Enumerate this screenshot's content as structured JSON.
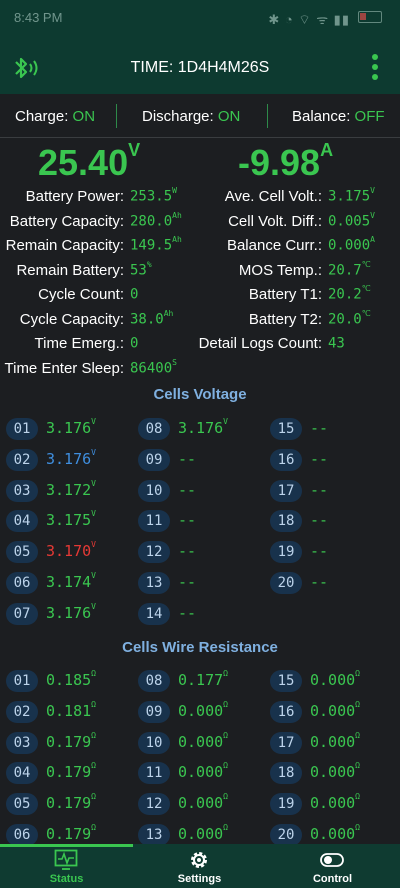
{
  "status_bar": {
    "time": "8:43 PM",
    "icons_text": "✱ ◔ ⌔ ᯤ ▮▮"
  },
  "app_bar": {
    "title": "TIME: 1D4H4M26S"
  },
  "switches": {
    "charge_label": "Charge:",
    "charge_value": "ON",
    "discharge_label": "Discharge:",
    "discharge_value": "ON",
    "balance_label": "Balance:",
    "balance_value": "OFF"
  },
  "voltage": {
    "value": "25.40",
    "unit": "V"
  },
  "current": {
    "value": "-9.98",
    "unit": "A"
  },
  "info_left": [
    {
      "label": "Battery Power:",
      "value": "253.5",
      "unit": "W"
    },
    {
      "label": "Battery Capacity:",
      "value": "280.0",
      "unit": "Ah"
    },
    {
      "label": "Remain Capacity:",
      "value": "149.5",
      "unit": "Ah"
    },
    {
      "label": "Remain Battery:",
      "value": "53",
      "unit": "%"
    },
    {
      "label": "Cycle Count:",
      "value": "0",
      "unit": ""
    },
    {
      "label": "Cycle Capacity:",
      "value": "38.0",
      "unit": "Ah"
    },
    {
      "label": "Time Emerg.:",
      "value": "0",
      "unit": ""
    },
    {
      "label": "Time Enter Sleep:",
      "value": "86400",
      "unit": "S"
    }
  ],
  "info_right": [
    {
      "label": "Ave. Cell Volt.:",
      "value": "3.175",
      "unit": "V"
    },
    {
      "label": "Cell Volt. Diff.:",
      "value": "0.005",
      "unit": "V"
    },
    {
      "label": "Balance Curr.:",
      "value": "0.000",
      "unit": "A"
    },
    {
      "label": "MOS Temp.:",
      "value": "20.7",
      "unit": "℃"
    },
    {
      "label": "Battery T1:",
      "value": "20.2",
      "unit": "℃"
    },
    {
      "label": "Battery T2:",
      "value": "20.0",
      "unit": "℃"
    },
    {
      "label": "Detail Logs Count:",
      "value": "43",
      "unit": ""
    }
  ],
  "cells_voltage": {
    "title": "Cells Voltage",
    "cells": [
      {
        "num": "01",
        "value": "3.176",
        "unit": "V",
        "state": "normal"
      },
      {
        "num": "02",
        "value": "3.176",
        "unit": "V",
        "state": "max"
      },
      {
        "num": "03",
        "value": "3.172",
        "unit": "V",
        "state": "normal"
      },
      {
        "num": "04",
        "value": "3.175",
        "unit": "V",
        "state": "normal"
      },
      {
        "num": "05",
        "value": "3.170",
        "unit": "V",
        "state": "min"
      },
      {
        "num": "06",
        "value": "3.174",
        "unit": "V",
        "state": "normal"
      },
      {
        "num": "07",
        "value": "3.176",
        "unit": "V",
        "state": "normal"
      },
      {
        "num": "08",
        "value": "3.176",
        "unit": "V",
        "state": "normal"
      },
      {
        "num": "09",
        "value": "--",
        "unit": "",
        "state": "normal"
      },
      {
        "num": "10",
        "value": "--",
        "unit": "",
        "state": "normal"
      },
      {
        "num": "11",
        "value": "--",
        "unit": "",
        "state": "normal"
      },
      {
        "num": "12",
        "value": "--",
        "unit": "",
        "state": "normal"
      },
      {
        "num": "13",
        "value": "--",
        "unit": "",
        "state": "normal"
      },
      {
        "num": "14",
        "value": "--",
        "unit": "",
        "state": "normal"
      },
      {
        "num": "15",
        "value": "--",
        "unit": "",
        "state": "normal"
      },
      {
        "num": "16",
        "value": "--",
        "unit": "",
        "state": "normal"
      },
      {
        "num": "17",
        "value": "--",
        "unit": "",
        "state": "normal"
      },
      {
        "num": "18",
        "value": "--",
        "unit": "",
        "state": "normal"
      },
      {
        "num": "19",
        "value": "--",
        "unit": "",
        "state": "normal"
      },
      {
        "num": "20",
        "value": "--",
        "unit": "",
        "state": "normal"
      }
    ]
  },
  "cells_resistance": {
    "title": "Cells Wire Resistance",
    "cells": [
      {
        "num": "01",
        "value": "0.185",
        "unit": "Ω"
      },
      {
        "num": "02",
        "value": "0.181",
        "unit": "Ω"
      },
      {
        "num": "03",
        "value": "0.179",
        "unit": "Ω"
      },
      {
        "num": "04",
        "value": "0.179",
        "unit": "Ω"
      },
      {
        "num": "05",
        "value": "0.179",
        "unit": "Ω"
      },
      {
        "num": "06",
        "value": "0.179",
        "unit": "Ω"
      },
      {
        "num": "08",
        "value": "0.177",
        "unit": "Ω"
      },
      {
        "num": "09",
        "value": "0.000",
        "unit": "Ω"
      },
      {
        "num": "10",
        "value": "0.000",
        "unit": "Ω"
      },
      {
        "num": "11",
        "value": "0.000",
        "unit": "Ω"
      },
      {
        "num": "12",
        "value": "0.000",
        "unit": "Ω"
      },
      {
        "num": "13",
        "value": "0.000",
        "unit": "Ω"
      },
      {
        "num": "15",
        "value": "0.000",
        "unit": "Ω"
      },
      {
        "num": "16",
        "value": "0.000",
        "unit": "Ω"
      },
      {
        "num": "17",
        "value": "0.000",
        "unit": "Ω"
      },
      {
        "num": "18",
        "value": "0.000",
        "unit": "Ω"
      },
      {
        "num": "19",
        "value": "0.000",
        "unit": "Ω"
      },
      {
        "num": "20",
        "value": "0.000",
        "unit": "Ω"
      }
    ]
  },
  "tabs": [
    {
      "label": "Status",
      "icon": "monitor-pulse-icon",
      "active": true
    },
    {
      "label": "Settings",
      "icon": "gear-icon",
      "active": false
    },
    {
      "label": "Control",
      "icon": "toggle-icon",
      "active": false
    }
  ],
  "colors": {
    "accent": "#3ac650",
    "header": "#0d3a30",
    "background": "#1c1e21",
    "cell_max": "#3f8ede",
    "cell_min": "#e53935",
    "section_title": "#7fb0e0"
  }
}
